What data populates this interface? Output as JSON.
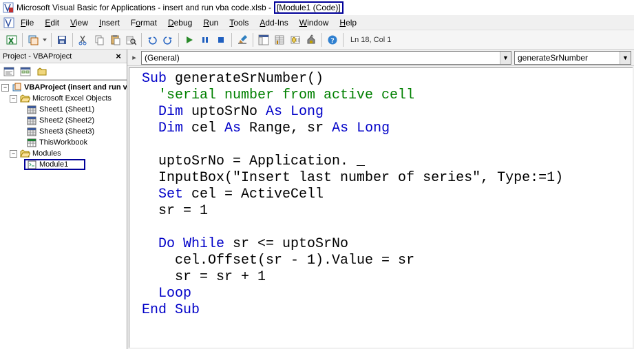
{
  "title": {
    "prefix": "Microsoft Visual Basic for Applications - insert and run vba code.xlsb - ",
    "highlight": "[Module1 (Code)]"
  },
  "menus": [
    "File",
    "Edit",
    "View",
    "Insert",
    "Format",
    "Debug",
    "Run",
    "Tools",
    "Add-Ins",
    "Window",
    "Help"
  ],
  "toolbar_status": "Ln 18, Col 1",
  "project_panel": {
    "title": "Project - VBAProject",
    "root": "VBAProject (insert and run vba code.xlsb)",
    "folder1": "Microsoft Excel Objects",
    "sheets": [
      "Sheet1 (Sheet1)",
      "Sheet2 (Sheet2)",
      "Sheet3 (Sheet3)",
      "ThisWorkbook"
    ],
    "folder2": "Modules",
    "module": "Module1"
  },
  "dropdowns": {
    "left": "(General)",
    "right": "generateSrNumber"
  },
  "code": {
    "l1a": "Sub ",
    "l1b": "generateSrNumber()",
    "l2": "  'serial number from active cell",
    "l3a": "  Dim ",
    "l3b": "uptoSrNo ",
    "l3c": "As Long",
    "l4a": "  Dim ",
    "l4b": "cel ",
    "l4c": "As ",
    "l4d": "Range, sr ",
    "l4e": "As Long",
    "l5": "",
    "l6": "  uptoSrNo = Application. _",
    "l7": "  InputBox(\"Insert last number of series\", Type:=1)",
    "l8a": "  Set ",
    "l8b": "cel = ActiveCell",
    "l9": "  sr = 1",
    "l10": "",
    "l11a": "  Do While ",
    "l11b": "sr <= uptoSrNo",
    "l12": "    cel.Offset(sr - 1).Value = sr",
    "l13": "    sr = sr + 1",
    "l14": "  Loop",
    "l15": "End Sub"
  }
}
